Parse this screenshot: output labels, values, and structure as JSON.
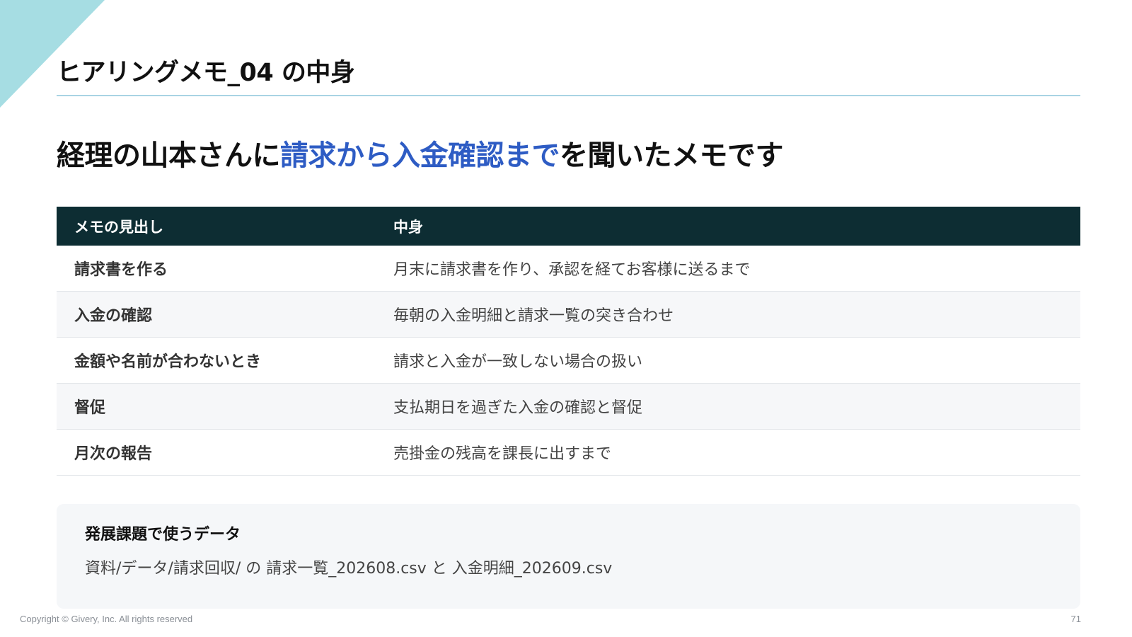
{
  "slide": {
    "title": "ヒアリングメモ_04 の中身",
    "headline": {
      "before": "経理の山本さんに",
      "highlight": "請求から入金確認まで",
      "after": "を聞いたメモです"
    },
    "accent_color": "#a6dde3",
    "highlight_color": "#2e5cc4"
  },
  "table": {
    "header_color": "#0d2d33",
    "columns": [
      "メモの見出し",
      "中身"
    ],
    "rows": [
      {
        "heading": "請求書を作る",
        "content": "月末に請求書を作り、承認を経てお客様に送るまで"
      },
      {
        "heading": "入金の確認",
        "content": "毎朝の入金明細と請求一覧の突き合わせ"
      },
      {
        "heading": "金額や名前が合わないとき",
        "content": "請求と入金が一致しない場合の扱い"
      },
      {
        "heading": "督促",
        "content": "支払期日を過ぎた入金の確認と督促"
      },
      {
        "heading": "月次の報告",
        "content": "売掛金の残高を課長に出すまで"
      }
    ]
  },
  "info_box": {
    "title": "発展課題で使うデータ",
    "text": "資料/データ/請求回収/ の 請求一覧_202608.csv と 入金明細_202609.csv"
  },
  "footer": {
    "copyright": "Copyright © Givery, Inc. All rights reserved",
    "page_number": "71"
  }
}
